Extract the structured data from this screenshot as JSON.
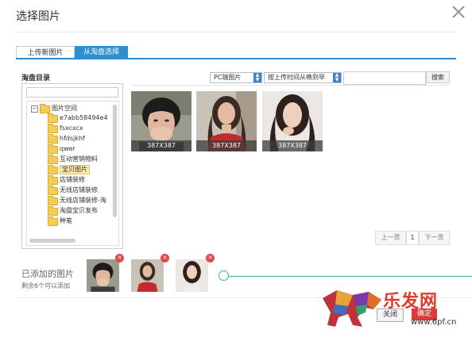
{
  "dialog": {
    "title": "选择图片"
  },
  "tabs": [
    {
      "label": "上传新图片",
      "active": false
    },
    {
      "label": "从淘盘选择",
      "active": true
    }
  ],
  "directory": {
    "label": "淘盘目录",
    "root": "图片空间",
    "root_expander": "−",
    "items": [
      "e7abb58494e4",
      "fsxcxcx",
      "hfdsjkhf",
      "qwer",
      "互动营销物料",
      "宝贝图片",
      "店铺装修",
      "无线店铺装修",
      "无线店铺装修-淘",
      "淘盘宝贝发布",
      "种笔"
    ],
    "selected_index": 5
  },
  "toolbar": {
    "type_select": "PC端图片",
    "sort_select": "按上传时间从晚到早",
    "search_placeholder": "",
    "search_button": "搜索"
  },
  "images": [
    {
      "size": "387X387"
    },
    {
      "size": "387X387"
    },
    {
      "size": "387X387"
    }
  ],
  "pagination": {
    "prev": "上一页",
    "current": "1",
    "next": "下一页"
  },
  "added": {
    "label": "已添加的图片",
    "remaining": "剩余6个可以添加",
    "count": 3,
    "remove_glyph": "✕"
  },
  "footer": {
    "close_button": "关闭",
    "ok_button": "确定"
  },
  "watermark": {
    "text": "乐发网",
    "url": "www.6pf.cn"
  },
  "colors": {
    "accent": "#2d8fd3",
    "progress": "#3fb39a",
    "remove": "#e04a4a",
    "folder": "#f5cd55"
  }
}
